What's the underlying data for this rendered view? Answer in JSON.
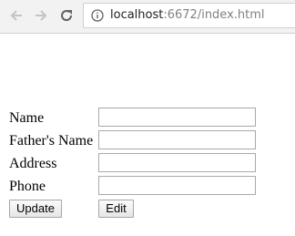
{
  "browser": {
    "url_host": "localhost",
    "url_rest": ":6672/index.html"
  },
  "form": {
    "fields": [
      {
        "label": "Name",
        "value": ""
      },
      {
        "label": "Father's Name",
        "value": ""
      },
      {
        "label": "Address",
        "value": ""
      },
      {
        "label": "Phone",
        "value": ""
      }
    ],
    "update_label": "Update",
    "edit_label": "Edit"
  }
}
